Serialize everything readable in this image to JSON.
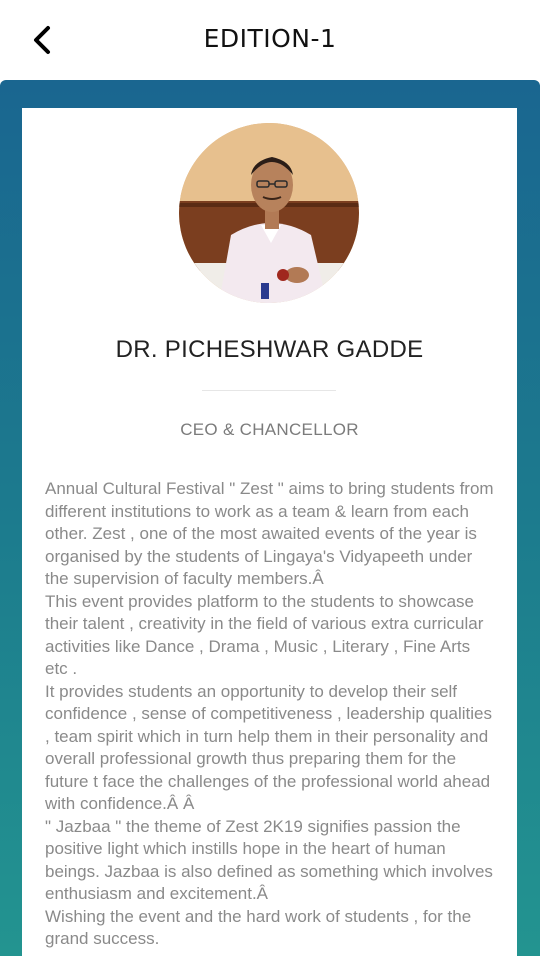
{
  "header": {
    "title": "EDITION-1",
    "back_icon": "chevron-left-icon"
  },
  "profile": {
    "name": "DR. PICHESHWAR GADDE",
    "role": "CEO & CHANCELLOR",
    "avatar": "profile-photo"
  },
  "body": {
    "paragraphs": [
      "Annual Cultural Festival \" Zest \" aims to bring students from different institutions to work as a team & learn from each other. Zest , one of the most awaited events of the year is organised by the students of Lingaya's Vidyapeeth under the supervision of faculty members.Â",
      "This event provides platform to the students to showcase their talent , creativity in the field of various extra curricular activities like Dance , Drama , Music , Literary , Fine Arts etc .",
      "It provides students an opportunity to develop their self confidence , sense of competitiveness , leadership qualities , team spirit which in turn help them in their personality and overall professional growth thus preparing them for the future t face the challenges of the professional world ahead with confidence.Â Â",
      "\" Jazbaa \" the theme of Zest 2K19 signifies passion the positive light which instills hope in the heart of human beings. Jazbaa is also defined as something which involves enthusiasm and excitement.Â",
      "Wishing the event and the hard work of students , for the grand success."
    ]
  },
  "colors": {
    "panel_top": "#1a6690",
    "panel_bottom": "#239490",
    "text_body": "#8a8a8a"
  }
}
